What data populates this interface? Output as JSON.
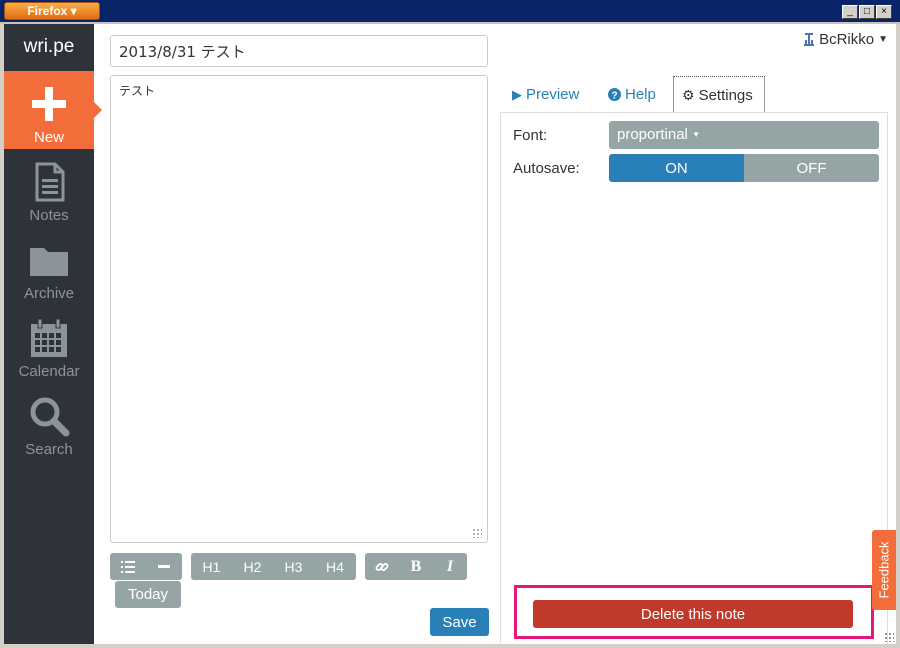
{
  "browser": {
    "menu_label": "Firefox",
    "controls": [
      "_",
      "□",
      "×"
    ]
  },
  "sidebar": {
    "logo": "wri.pe",
    "items": [
      {
        "label": "New",
        "icon": "plus-icon",
        "active": true
      },
      {
        "label": "Notes",
        "icon": "document-icon",
        "active": false
      },
      {
        "label": "Archive",
        "icon": "folder-icon",
        "active": false
      },
      {
        "label": "Calendar",
        "icon": "calendar-icon",
        "active": false
      },
      {
        "label": "Search",
        "icon": "search-icon",
        "active": false
      }
    ]
  },
  "editor": {
    "title_value": "2013/8/31 テスト",
    "body_value": "テスト",
    "toolbar": {
      "list_icon": "list-icon",
      "hr_icon": "minus-icon",
      "headings": [
        "H1",
        "H2",
        "H3",
        "H4"
      ],
      "link_icon": "link-icon",
      "bold": "B",
      "italic": "I"
    },
    "today_label": "Today",
    "save_label": "Save"
  },
  "user_menu": {
    "username": "BcRikko"
  },
  "tabs": [
    {
      "label": "Preview",
      "icon": "play-icon",
      "active": false
    },
    {
      "label": "Help",
      "icon": "question-icon",
      "active": false
    },
    {
      "label": "Settings",
      "icon": "gear-icon",
      "active": true
    }
  ],
  "settings": {
    "font_label": "Font:",
    "font_value": "proportinal",
    "autosave_label": "Autosave:",
    "autosave_on": "ON",
    "autosave_off": "OFF",
    "autosave_state": "ON"
  },
  "delete_label": "Delete this note",
  "feedback_label": "Feedback",
  "colors": {
    "sidebar_bg": "#2e3339",
    "accent_orange": "#f36d3a",
    "primary_blue": "#2980b9",
    "muted_gray": "#95a5a6",
    "danger_red": "#c0392b",
    "highlight_pink": "#e5177b"
  }
}
